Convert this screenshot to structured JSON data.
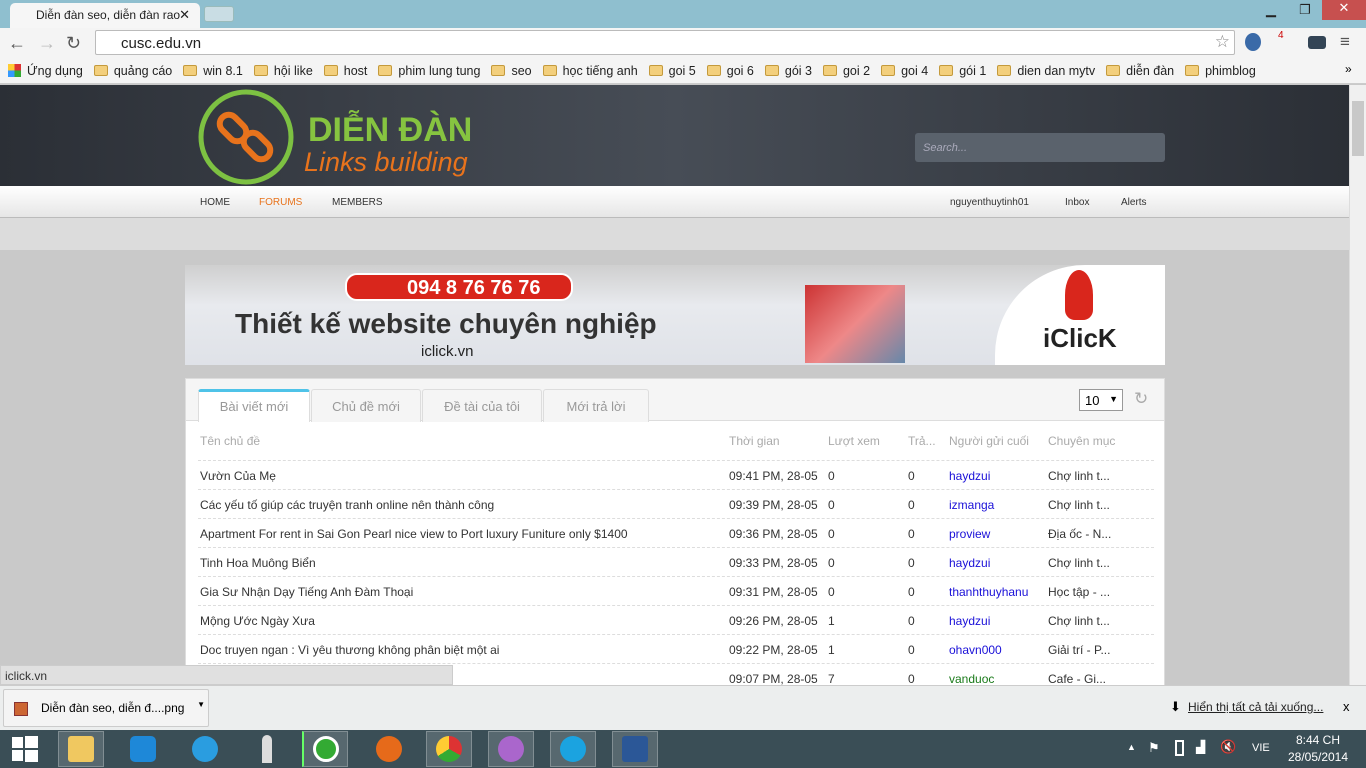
{
  "browser": {
    "tab_title": "Diễn đàn seo, diễn đàn rao",
    "url": "cusc.edu.vn",
    "extension_badge": "4",
    "bookmarks": [
      "Ứng dụng",
      "quảng cáo",
      "win 8.1",
      "hội like",
      "host",
      "phim lung tung",
      "seo",
      "học tiếng anh",
      "goi 5",
      "goi 6",
      "gói 3",
      "goi 2",
      "goi 4",
      "gói 1",
      "dien dan mytv",
      "diễn đàn",
      "phimblog"
    ]
  },
  "site": {
    "logo_line1": "DIỄN ĐÀN",
    "logo_line2": "Links building",
    "search_placeholder": "Search...",
    "nav_left": [
      "HOME",
      "FORUMS",
      "MEMBERS"
    ],
    "nav_right": [
      "nguyenthuytinh01",
      "Inbox",
      "Alerts"
    ],
    "accent": "#e8731c",
    "banner": {
      "phone": "094 8 76 76 76",
      "headline": "Thiết kế website chuyên nghiệp",
      "domain": "iclick.vn",
      "brand": "iClicK"
    }
  },
  "panel": {
    "tabs": [
      "Bài viết mới",
      "Chủ đề mới",
      "Đề tài của tôi",
      "Mới trả lời"
    ],
    "per_page": "10",
    "headers": [
      "Tên chủ đề",
      "Thời gian",
      "Lượt xem",
      "Trả...",
      "Người gửi cuối",
      "Chuyên mục"
    ],
    "rows": [
      [
        "Vườn Của Mẹ",
        "09:41 PM, 28-05",
        "0",
        "0",
        "haydzui",
        "Chợ linh t..."
      ],
      [
        "Các yếu tố giúp các truyện tranh online nên thành công",
        "09:39 PM, 28-05",
        "0",
        "0",
        "izmanga",
        "Chợ linh t..."
      ],
      [
        "Apartment For rent in Sai Gon Pearl nice view to Port luxury Funiture only $1400",
        "09:36 PM, 28-05",
        "0",
        "0",
        "proview",
        "Địa ốc - N..."
      ],
      [
        "Tinh Hoa Muông Biển",
        "09:33 PM, 28-05",
        "0",
        "0",
        "haydzui",
        "Chợ linh t..."
      ],
      [
        "Gia Sư Nhận Dạy Tiếng Anh Đàm Thoại",
        "09:31 PM, 28-05",
        "0",
        "0",
        "thanhthuyhanu",
        "Học tập - ..."
      ],
      [
        "Mộng Ước Ngày Xưa",
        "09:26 PM, 28-05",
        "1",
        "0",
        "haydzui",
        "Chợ linh t..."
      ],
      [
        "Doc truyen ngan : Vì yêu thương không phân biệt một ai",
        "09:22 PM, 28-05",
        "1",
        "0",
        "ohavn000",
        "Giải trí - P..."
      ],
      [
        "",
        "09:07 PM, 28-05",
        "7",
        "0",
        "vanduoc",
        "Cafe - Gi..."
      ]
    ]
  },
  "status_url": "iclick.vn",
  "downloads": {
    "file": "Diễn đàn seo, diễn đ....png",
    "show_all": "Hiển thị tất cả tải xuống...",
    "close": "x"
  },
  "taskbar": {
    "lang": "VIE",
    "time": "8:44 CH",
    "date": "28/05/2014"
  }
}
